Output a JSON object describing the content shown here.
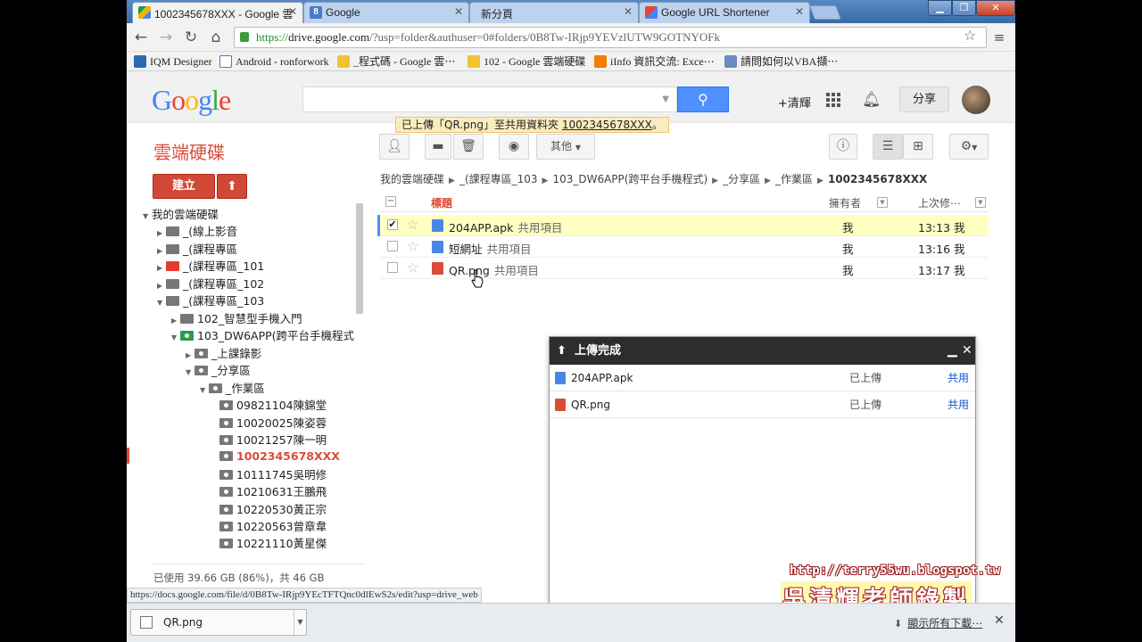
{
  "browser": {
    "tabs": [
      {
        "title": "1002345678XXX - Google 雲",
        "favicon": "drive",
        "active": true
      },
      {
        "title": "Google",
        "favicon": "google-search",
        "active": false
      },
      {
        "title": "新分頁",
        "favicon": "none",
        "active": false
      },
      {
        "title": "Google URL Shortener",
        "favicon": "google",
        "active": false
      }
    ],
    "url": {
      "scheme": "https://",
      "host": "drive.google.com",
      "path": "/?usp=folder&authuser=0#folders/0B8Tw-IRjp9YEVzlUTW9GOTNYOFk"
    },
    "bookmarks": [
      {
        "label": "IQM Designer",
        "color": "#2a6ab0"
      },
      {
        "label": "Android - ronforwork",
        "color": "#4a7ac8"
      },
      {
        "label": "_程式碼 - Google 雲⋯",
        "color": "#f1c232"
      },
      {
        "label": "102 - Google 雲端硬碟",
        "color": "#f1c232"
      },
      {
        "label": "iInfo 資訊交流: Exce⋯",
        "color": "#f57c00"
      },
      {
        "label": "請問如何以VBA擷⋯",
        "color": "#6a8ac0"
      }
    ]
  },
  "header": {
    "logo": "Google",
    "logo_colors": [
      "#4285f4",
      "#ea4335",
      "#fbbc05",
      "#4285f4",
      "#34a853",
      "#ea4335"
    ],
    "user_link": "+清輝",
    "share_label": "分享",
    "notice_prefix": "已上傳「QR.png」至共用資料夾 ",
    "notice_link": "1002345678XXX",
    "notice_suffix": "。"
  },
  "drive": {
    "title": "雲端硬碟",
    "more_label": "其他",
    "create_label": "建立",
    "storage": "已使用 39.66 GB (86%)，共 46 GB"
  },
  "tree": [
    {
      "label": "我的雲端硬碟",
      "type": "root"
    },
    {
      "label": "_(線上影音",
      "type": "gray"
    },
    {
      "label": "_(課程專區",
      "type": "gray"
    },
    {
      "label": "_(課程專區_101",
      "type": "red"
    },
    {
      "label": "_(課程專區_102",
      "type": "gray"
    },
    {
      "label": "_(課程專區_103",
      "type": "gray"
    },
    {
      "label": "102_智慧型手機入門",
      "type": "gray"
    },
    {
      "label": "103_DW6APP(跨平台手機程式",
      "type": "green"
    },
    {
      "label": "_上課錄影",
      "type": "shared"
    },
    {
      "label": "_分享區",
      "type": "shared"
    },
    {
      "label": "_作業區",
      "type": "shared"
    },
    {
      "label": "09821104陳錦堂",
      "type": "shared"
    },
    {
      "label": "10020025陳姿蓉",
      "type": "shared"
    },
    {
      "label": "10021257陳一明",
      "type": "shared"
    },
    {
      "label": "1002345678XXX",
      "type": "shared"
    },
    {
      "label": "10111745吳明修",
      "type": "shared"
    },
    {
      "label": "10210631王鵬飛",
      "type": "shared"
    },
    {
      "label": "10220530黃正宗",
      "type": "shared"
    },
    {
      "label": "10220563曾章韋",
      "type": "shared"
    },
    {
      "label": "10221110黃星傑",
      "type": "shared"
    }
  ],
  "breadcrumb": [
    "我的雲端硬碟",
    "_(課程專區_103",
    "103_DW6APP(跨平台手機程式)",
    "_分享區",
    "_作業區",
    "1002345678XXX"
  ],
  "columns": {
    "title": "標題",
    "owner": "擁有者",
    "modified": "上次修⋯"
  },
  "files": [
    {
      "name": "204APP.apk",
      "tag": "共用項目",
      "owner": "我",
      "modified": "13:13 我",
      "kind": "file",
      "color": "#4a86e8"
    },
    {
      "name": "短網址",
      "tag": "共用項目",
      "owner": "我",
      "modified": "13:16 我",
      "kind": "doc",
      "color": "#4a86e8"
    },
    {
      "name": "QR.png",
      "tag": "共用項目",
      "owner": "我",
      "modified": "13:17 我",
      "kind": "image",
      "color": "#dd4b39"
    }
  ],
  "upload_panel": {
    "title": "上傳完成",
    "items": [
      {
        "name": "204APP.apk",
        "status": "已上傳",
        "action": "共用",
        "color": "#4a86e8"
      },
      {
        "name": "QR.png",
        "status": "已上傳",
        "action": "共用",
        "color": "#dd4b39"
      }
    ]
  },
  "status_url": "https://docs.google.com/file/d/0B8Tw-IRjp9YEcTFTQnc0dlEwS2s/edit?usp=drive_web",
  "download": {
    "file": "QR.png",
    "show_all": "顯示所有下載⋯"
  },
  "watermark": {
    "url": "http://terry55wu.blogspot.tw",
    "name": "吳清輝老師錄製"
  }
}
